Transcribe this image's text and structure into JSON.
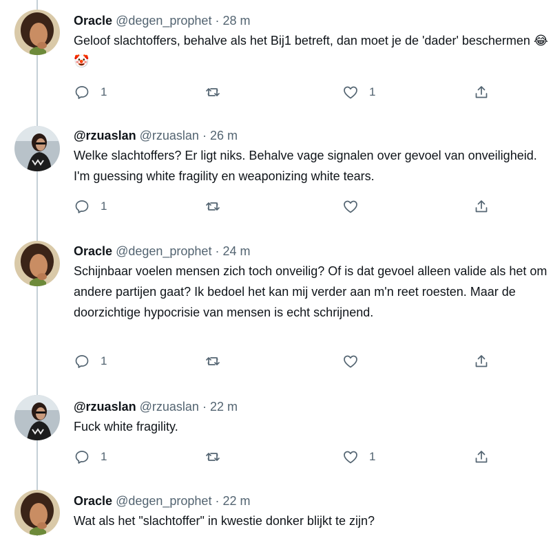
{
  "tweets": [
    {
      "name": "Oracle",
      "handle": "@degen_prophet",
      "separator": "·",
      "time": "28 m",
      "text": "Geloof slachtoffers, behalve als het Bij1 betreft, dan moet je de 'dader' beschermen 😂🤡",
      "replies": "1",
      "retweets": "",
      "likes": "1",
      "avatar": "oracle"
    },
    {
      "name": "@rzuaslan",
      "handle": "@rzuaslan",
      "separator": "·",
      "time": "26 m",
      "text": "Welke slachtoffers? Er ligt niks. Behalve vage signalen over gevoel van onveiligheid. I'm guessing white fragility en weaponizing white tears.",
      "replies": "1",
      "retweets": "",
      "likes": "",
      "avatar": "rzuaslan"
    },
    {
      "name": "Oracle",
      "handle": "@degen_prophet",
      "separator": "·",
      "time": "24 m",
      "text": "Schijnbaar voelen mensen zich toch onveilig? Of is dat gevoel alleen valide als het om andere partijen gaat? Ik bedoel het kan mij verder aan m'n reet roesten. Maar de doorzichtige hypocrisie van mensen is echt schrijnend.",
      "replies": "1",
      "retweets": "",
      "likes": "",
      "avatar": "oracle"
    },
    {
      "name": "@rzuaslan",
      "handle": "@rzuaslan",
      "separator": "·",
      "time": "22 m",
      "text": "Fuck white fragility.",
      "replies": "1",
      "retweets": "",
      "likes": "1",
      "avatar": "rzuaslan"
    },
    {
      "name": "Oracle",
      "handle": "@degen_prophet",
      "separator": "·",
      "time": "22 m",
      "text": "Wat als het \"slachtoffer\" in kwestie donker blijkt te zijn?",
      "avatar": "oracle"
    }
  ],
  "icons": {
    "reply": "reply-icon",
    "retweet": "retweet-icon",
    "like": "heart-icon",
    "share": "share-icon"
  },
  "colors": {
    "text": "#0f1419",
    "muted": "#536471",
    "thread_line": "#c4cfd6"
  }
}
